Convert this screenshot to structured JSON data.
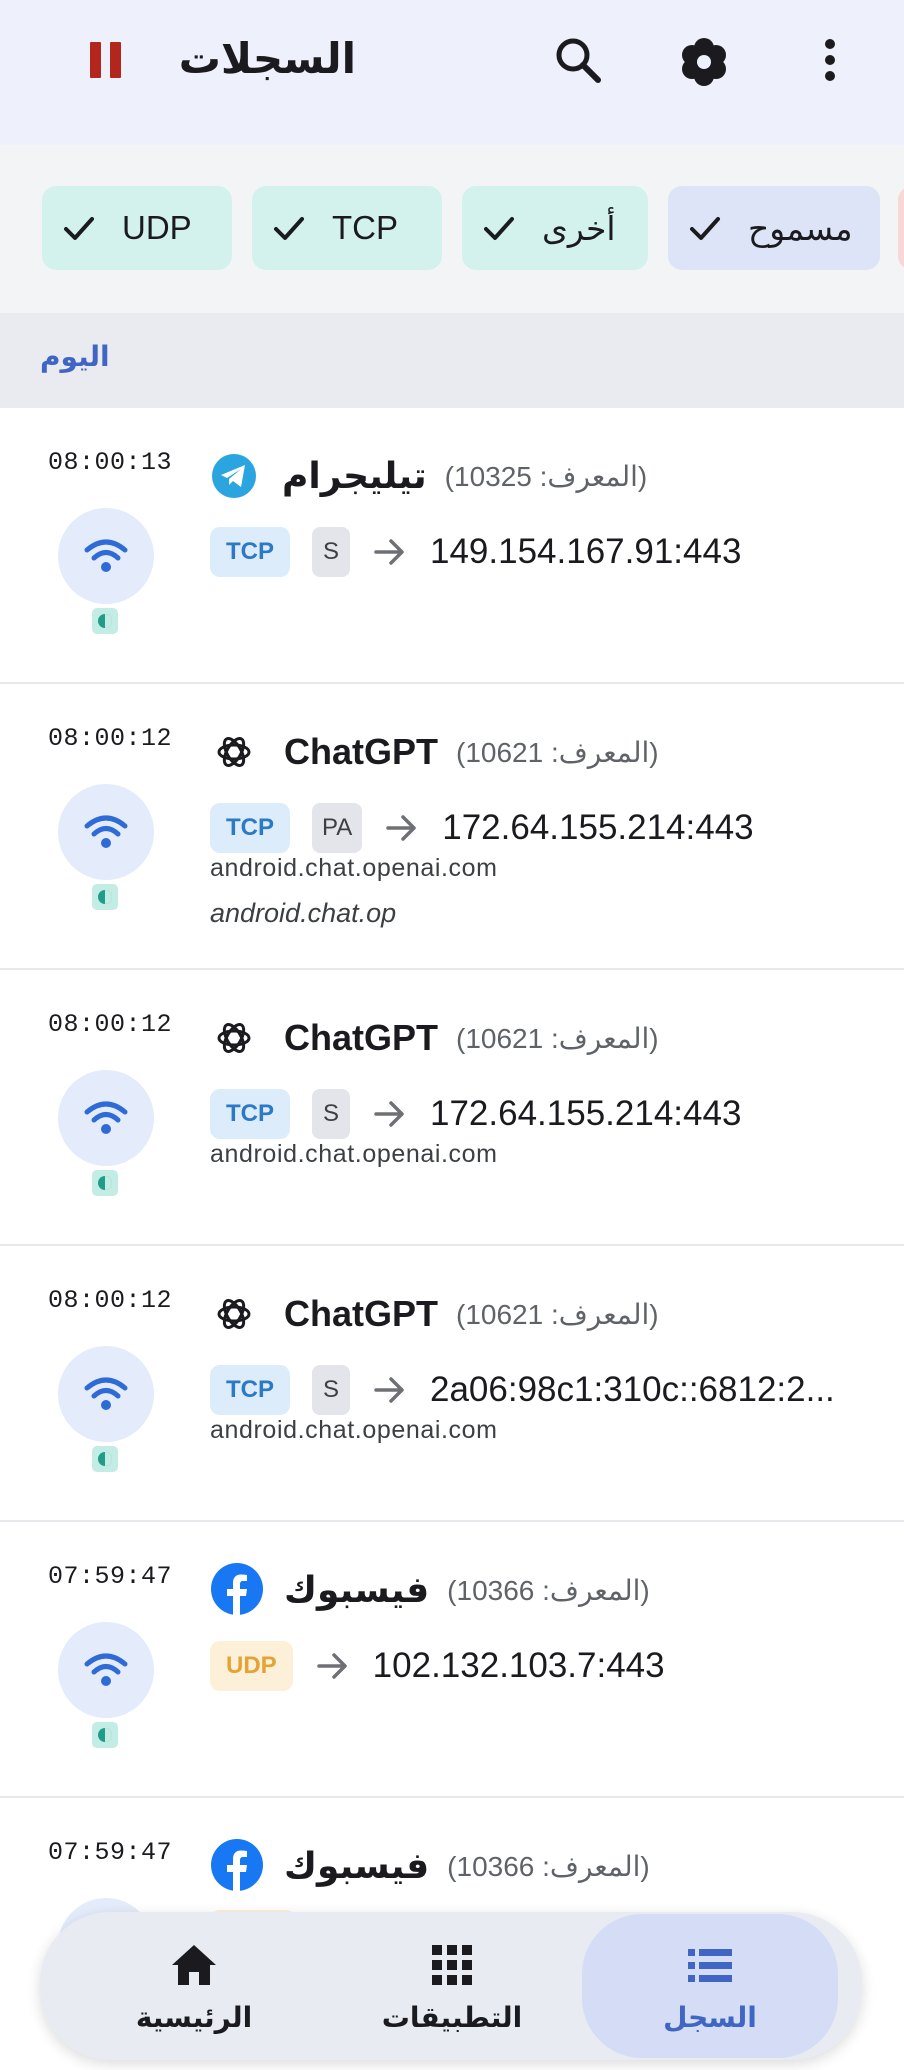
{
  "app_bar": {
    "title": "السجلات",
    "pause_icon": "pause-icon",
    "search_icon": "search-icon",
    "settings_icon": "gear-icon",
    "more_icon": "more-vert-icon",
    "accent_color": "#b3261e"
  },
  "filters": [
    {
      "label": "UDP",
      "checked": true
    },
    {
      "label": "TCP",
      "checked": true
    },
    {
      "label": "أخرى",
      "checked": true
    },
    {
      "label": "مسموح",
      "checked": true
    }
  ],
  "section": {
    "label": "اليوم"
  },
  "entries": [
    {
      "time": "08:00:13",
      "app": "تيليجرام",
      "uid": "(المعرف: 10325)",
      "icon": "telegram-icon",
      "protocol": "TCP",
      "flags": "S",
      "address": "149.154.167.91:443",
      "domain": "",
      "sni": ""
    },
    {
      "time": "08:00:12",
      "app": "ChatGPT",
      "uid": "(المعرف: 10621)",
      "icon": "openai-icon",
      "protocol": "TCP",
      "flags": "PA",
      "address": "172.64.155.214:443",
      "domain": "android.chat.openai.com",
      "sni": "android.chat.op"
    },
    {
      "time": "08:00:12",
      "app": "ChatGPT",
      "uid": "(المعرف: 10621)",
      "icon": "openai-icon",
      "protocol": "TCP",
      "flags": "S",
      "address": "172.64.155.214:443",
      "domain": "android.chat.openai.com",
      "sni": ""
    },
    {
      "time": "08:00:12",
      "app": "ChatGPT",
      "uid": "(المعرف: 10621)",
      "icon": "openai-icon",
      "protocol": "TCP",
      "flags": "S",
      "address": "2a06:98c1:310c::6812:2...",
      "domain": "android.chat.openai.com",
      "sni": ""
    },
    {
      "time": "07:59:47",
      "app": "فيسبوك",
      "uid": "(المعرف: 10366)",
      "icon": "facebook-icon",
      "protocol": "UDP",
      "flags": "",
      "address": "102.132.103.7:443",
      "domain": "",
      "sni": ""
    },
    {
      "time": "07:59:47",
      "app": "فيسبوك",
      "uid": "(المعرف: 10366)",
      "icon": "facebook-icon",
      "protocol": "",
      "flags": "",
      "address": "",
      "domain": "",
      "sni": ""
    }
  ],
  "bottom_nav": [
    {
      "label": "الرئيسية",
      "icon": "home-icon",
      "active": false
    },
    {
      "label": "التطبيقات",
      "icon": "apps-grid-icon",
      "active": false
    },
    {
      "label": "السجل",
      "icon": "list-icon",
      "active": true
    }
  ],
  "colors": {
    "tcp": "#2c7ac5",
    "udp": "#e5a235",
    "active_nav": "#3f66c4"
  }
}
